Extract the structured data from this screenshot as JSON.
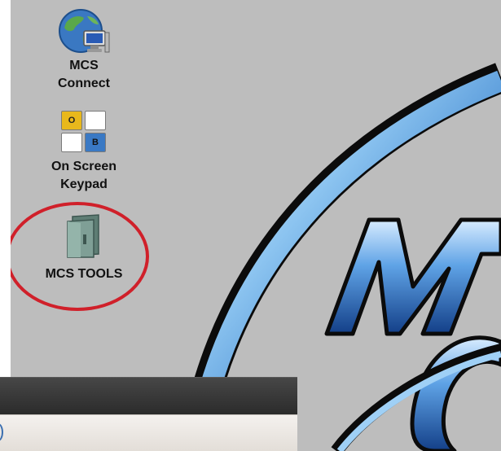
{
  "desktop": {
    "icons": [
      {
        "label_line1": "MCS",
        "label_line2": "Connect",
        "icon": "globe-network-icon"
      },
      {
        "label_line1": "On Screen",
        "label_line2": "Keypad",
        "icon": "keypad-icon",
        "keys": [
          "O",
          "",
          "",
          "B"
        ]
      },
      {
        "label": "MCS TOOLS",
        "icon": "folder-icon",
        "highlighted": true
      }
    ],
    "wallpaper": {
      "letters": [
        "M",
        "C"
      ],
      "accent": "#3f86d6"
    }
  },
  "colors": {
    "desktop_bg": "#bdbdbd",
    "highlight_ring": "#d0202a",
    "key_orange": "#e8b81c",
    "key_blue": "#3a79c4"
  }
}
